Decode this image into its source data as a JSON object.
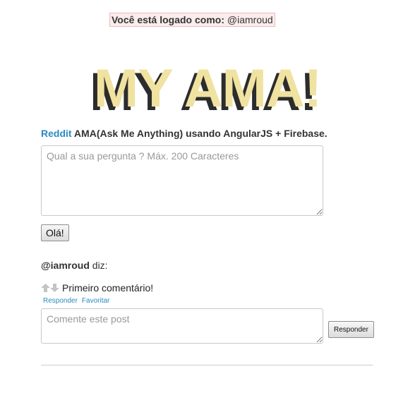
{
  "session": {
    "logged_in_label": "Você está logado como:",
    "username": "@iamroud"
  },
  "header": {
    "logo_text": "MY AMA!"
  },
  "tagline": {
    "link_text": "Reddit",
    "rest_text": " AMA(Ask Me Anything) usando AngularJS + Firebase."
  },
  "question_form": {
    "placeholder": "Qual a sua pergunta ? Máx. 200 Caracteres",
    "value": "",
    "submit_label": "Olá!"
  },
  "post": {
    "author": "@iamroud",
    "says": " diz:",
    "comment_text": "Primeiro comentário!",
    "actions": {
      "reply": "Responder",
      "favorite": "Favoritar"
    },
    "reply_form": {
      "placeholder": "Comente este post",
      "value": "",
      "submit_label": "Responder"
    }
  },
  "colors": {
    "logo_fill": "#f0e2a0",
    "logo_shadow": "#2c2c2c",
    "link": "#2a8bc0",
    "banner_bg": "#fbecec"
  }
}
